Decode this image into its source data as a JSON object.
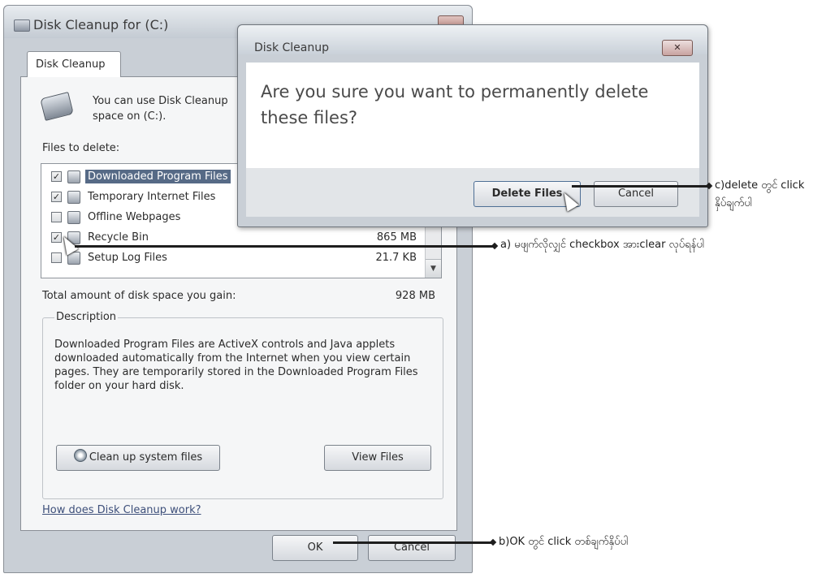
{
  "main_window": {
    "title": "Disk Cleanup for  (C:)",
    "tab_label": "Disk Cleanup",
    "intro_text": "You can use Disk Cleanup space on  (C:).",
    "files_label": "Files to delete:",
    "files": [
      {
        "name": "Downloaded Program Files",
        "size": "",
        "checked": true,
        "selected": true
      },
      {
        "name": "Temporary Internet Files",
        "size": "",
        "checked": true,
        "selected": false
      },
      {
        "name": "Offline Webpages",
        "size": "",
        "checked": false,
        "selected": false
      },
      {
        "name": "Recycle Bin",
        "size": "865 MB",
        "checked": true,
        "selected": false
      },
      {
        "name": "Setup Log Files",
        "size": "21.7 KB",
        "checked": false,
        "selected": false
      }
    ],
    "total_label": "Total amount of disk space you gain:",
    "total_value": "928 MB",
    "description_legend": "Description",
    "description_text": "Downloaded Program Files are ActiveX controls and Java applets downloaded automatically from the Internet when you view certain pages. They are temporarily stored in the Downloaded Program Files folder on your hard disk.",
    "cleanup_system_label": "Clean up system files",
    "view_files_label": "View Files",
    "help_link": "How does Disk Cleanup work?",
    "ok_label": "OK",
    "cancel_label": "Cancel"
  },
  "dialog": {
    "title": "Disk Cleanup",
    "close_glyph": "✕",
    "question": "Are you sure you want to permanently delete these files?",
    "delete_label": "Delete Files",
    "cancel_label": "Cancel"
  },
  "annotations": {
    "a": "a) မဖျက်လိုလျှင် checkbox အားclear လုပ်ရန်ပါ",
    "b": "b)OK တွင် click တစ်ချက်နှိပ်ပါ",
    "c_line1": "c)delete တွင် click",
    "c_line2": "နှိပ်ချက်ပါ"
  },
  "icons": {
    "check": "✓",
    "scroll_down": "▼"
  }
}
